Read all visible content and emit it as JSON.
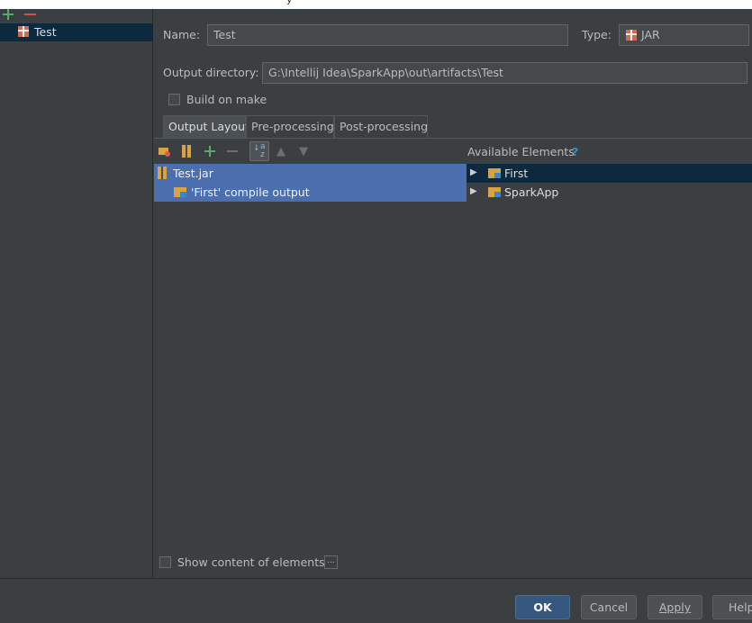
{
  "window": {
    "title_fragment": "y"
  },
  "sidebar": {
    "items": [
      {
        "label": "Test",
        "icon": "gift-icon"
      }
    ]
  },
  "form": {
    "name_label": "Name:",
    "name_value": "Test",
    "type_label": "Type:",
    "type_value": "JAR",
    "output_dir_label": "Output directory:",
    "output_dir_value": "G:\\Intellij Idea\\SparkApp\\out\\artifacts\\Test",
    "build_on_make_label": "Build on make",
    "build_on_make_checked": false
  },
  "tabs": [
    {
      "label": "Output Layout",
      "selected": true
    },
    {
      "label": "Pre-processing",
      "selected": false
    },
    {
      "label": "Post-processing",
      "selected": false
    }
  ],
  "layout_tree": {
    "root": "Test.jar",
    "children": [
      "'First' compile output"
    ]
  },
  "available": {
    "title": "Available Elements",
    "help": "?",
    "items": [
      {
        "label": "First",
        "selected": true
      },
      {
        "label": "SparkApp",
        "selected": false
      }
    ]
  },
  "footer": {
    "show_content_label": "Show content of elements",
    "show_content_checked": false,
    "more_button": "..."
  },
  "buttons": {
    "ok": "OK",
    "cancel": "Cancel",
    "apply": "Apply",
    "help": "Help"
  },
  "colors": {
    "background": "#3c3f41",
    "selection": "#4b6eaf",
    "inactive_selection": "#0d293e",
    "ok_button": "#365880"
  }
}
